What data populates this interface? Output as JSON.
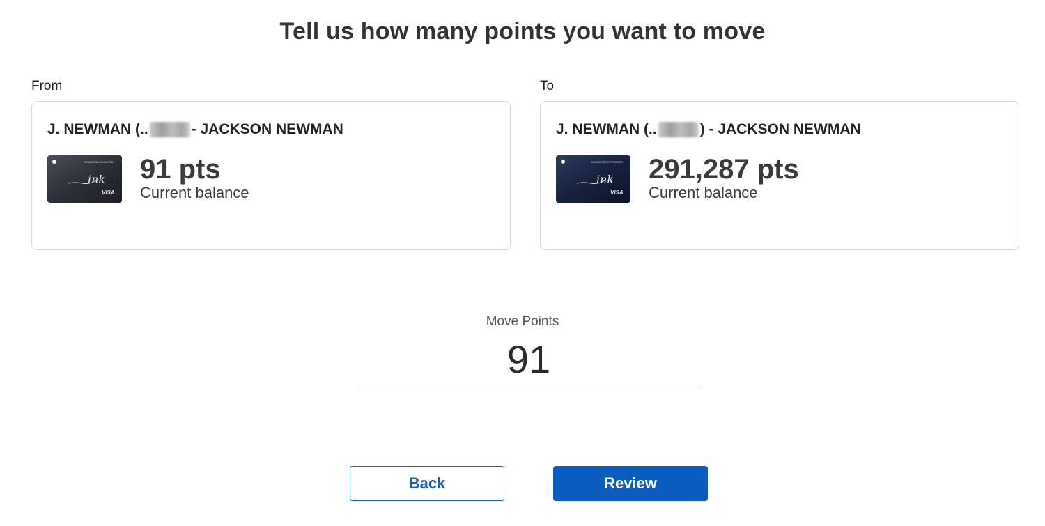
{
  "page": {
    "title": "Tell us how many points you want to move"
  },
  "from": {
    "label": "From",
    "account_name_prefix": "J. NEWMAN (..",
    "account_name_suffix": "- JACKSON NEWMAN",
    "card_type": "BUSINESS UNLIMITED",
    "card_brand": "ink",
    "card_network": "VISA",
    "points": "91 pts",
    "balance_label": "Current balance",
    "card_color": "#2b2f36"
  },
  "to": {
    "label": "To",
    "account_name_prefix": "J. NEWMAN (..",
    "account_name_suffix": ") - JACKSON NEWMAN",
    "card_type": "BUSINESS PREFERRED",
    "card_brand": "ink",
    "card_network": "VISA",
    "points": "291,287 pts",
    "balance_label": "Current balance",
    "card_color": "#15203a"
  },
  "move": {
    "label": "Move Points",
    "value": "91"
  },
  "buttons": {
    "back_label": "Back",
    "review_label": "Review"
  },
  "colors": {
    "primary": "#0a5cbf",
    "border": "#d5d8dc"
  }
}
